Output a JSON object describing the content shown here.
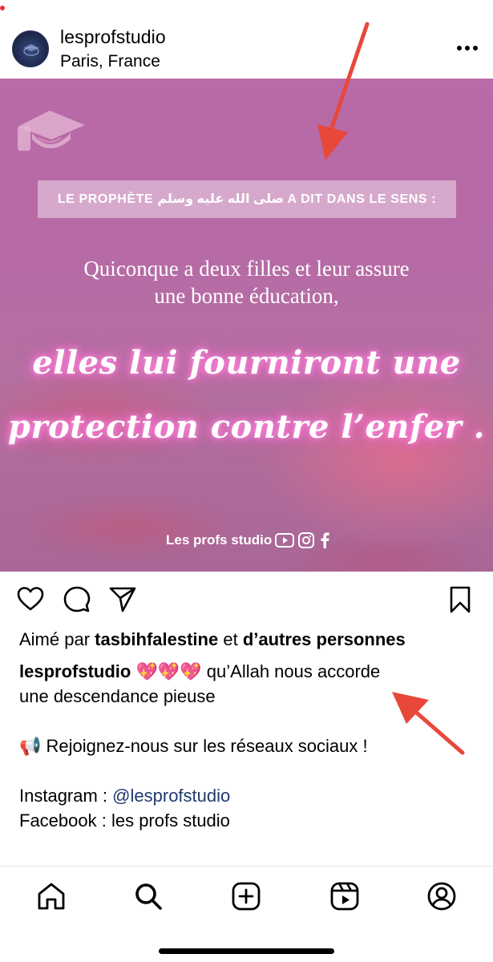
{
  "header": {
    "username": "lesprofstudio",
    "location": "Paris, France",
    "avatar_text": "LES PROFS STUDIO",
    "more_icon": "more-horizontal-icon"
  },
  "post_image": {
    "banner_text": "LE PROPHÈTE صلى الله عليه وسلم A DIT DANS LE SENS :",
    "quote_line1": "Quiconque a deux filles et leur assure",
    "quote_line2": "une bonne éducation,",
    "script_line1": "elles lui fourniront une",
    "script_line2": "protection contre l’enfer .",
    "brand_text": "Les profs studio",
    "brand_icons": [
      "youtube-icon",
      "instagram-icon",
      "facebook-icon"
    ],
    "graduation_cap_icon": "graduation-cap-icon"
  },
  "actions": {
    "like_icon": "heart-icon",
    "comment_icon": "comment-icon",
    "share_icon": "send-icon",
    "save_icon": "bookmark-icon"
  },
  "likes": {
    "prefix": "Aimé par",
    "user": "tasbihfalestine",
    "conj": "et",
    "others": "d’autres personnes"
  },
  "caption": {
    "user": "lesprofstudio",
    "emoji": "💖💖💖",
    "text_line1": "qu’Allah nous accorde",
    "text_line2": "une descendance pieuse",
    "megaphone_emoji": "📢",
    "social_line": "Rejoignez-nous sur les réseaux sociaux !",
    "instagram_label": "Instagram :",
    "instagram_handle": "@lesprofstudio",
    "facebook_line": "Facebook : les profs studio"
  },
  "tabbar": {
    "tabs": [
      "home-icon",
      "search-icon",
      "create-icon",
      "reels-icon",
      "profile-icon"
    ],
    "active_tab": "home-icon"
  },
  "colors": {
    "annotation_arrow": "#e8483a",
    "mention": "#1f3a6e",
    "notification_dot": "#ed2d3a"
  }
}
